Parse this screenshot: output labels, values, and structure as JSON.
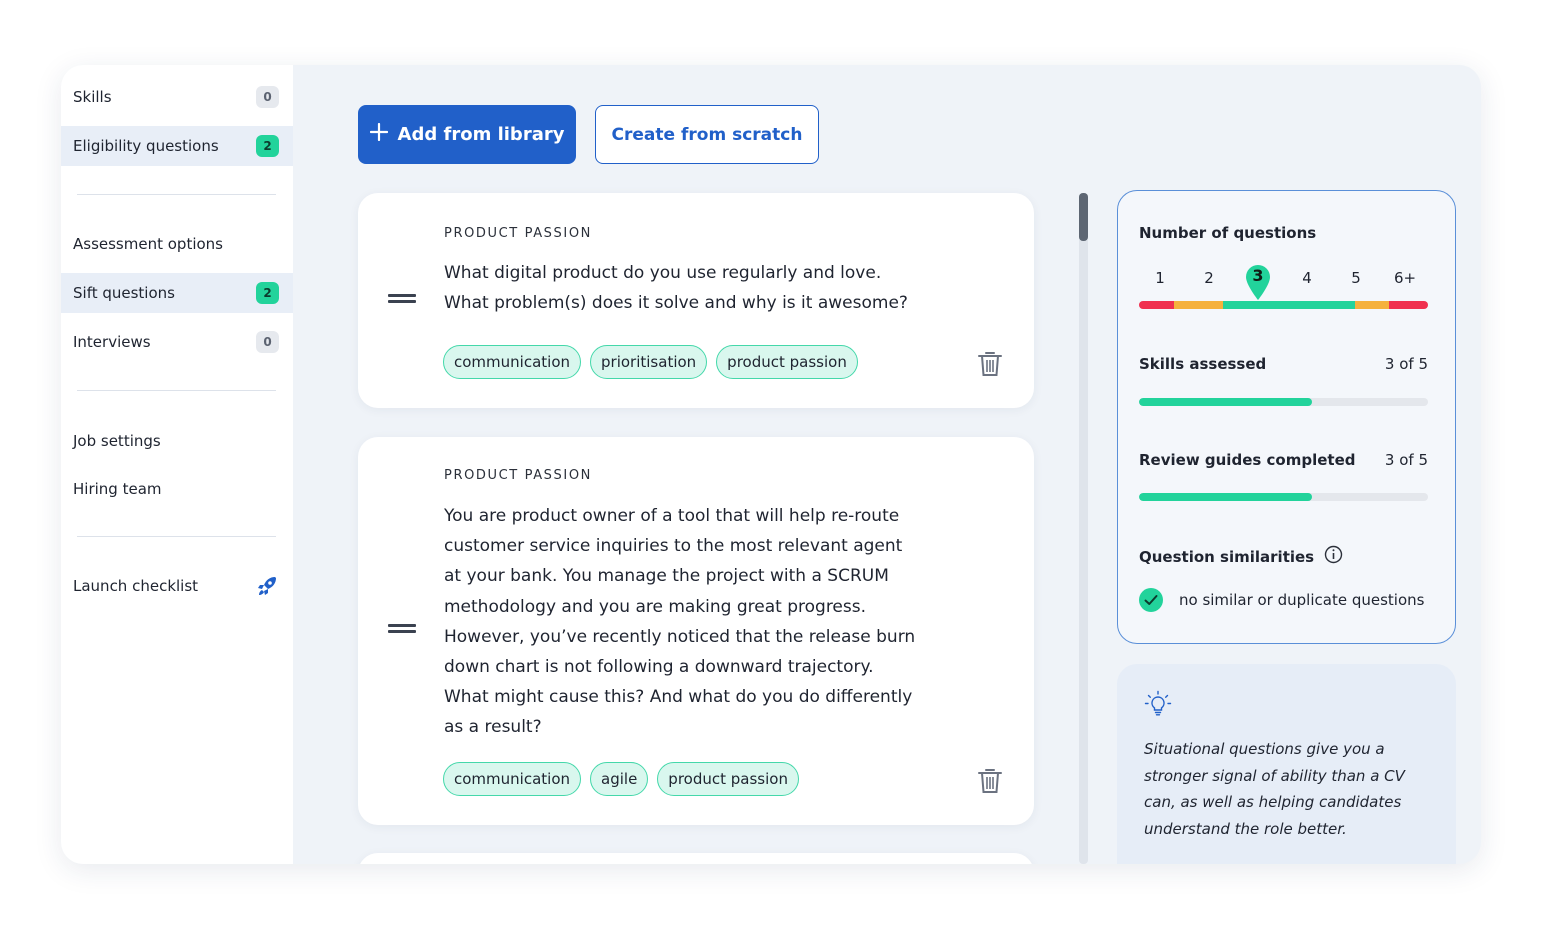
{
  "sidebar": {
    "items": [
      {
        "label": "Skills",
        "badge": "0"
      },
      {
        "label": "Eligibility questions",
        "badge": "2"
      },
      {
        "label": "Assessment options"
      },
      {
        "label": "Sift questions",
        "badge": "2"
      },
      {
        "label": "Interviews",
        "badge": "0"
      },
      {
        "label": "Job settings"
      },
      {
        "label": "Hiring team"
      },
      {
        "label": "Launch checklist",
        "icon": "rocket-icon"
      }
    ]
  },
  "toolbar": {
    "add_label": "Add from library",
    "create_label": "Create from scratch"
  },
  "questions": [
    {
      "category": "PRODUCT PASSION",
      "lines": [
        "What digital product do you use regularly and love.",
        "What problem(s) does it solve and why is it awesome?"
      ],
      "tags": [
        "communication",
        "prioritisation",
        "product passion"
      ]
    },
    {
      "category": "PRODUCT PASSION",
      "lines": [
        "You are product owner of a tool that will help re-route",
        "customer service inquiries to the most relevant agent",
        "at your bank. You manage the project with a SCRUM",
        "methodology and you are making great progress.",
        "However, you’ve recently noticed that the release burn",
        "down chart is not following a downward trajectory.",
        "What might cause this? And what do you do differently",
        "as a result?"
      ],
      "tags": [
        "communication",
        "agile",
        "product passion"
      ]
    }
  ],
  "stats": {
    "count_label": "Number of questions",
    "options": [
      "1",
      "2",
      "3",
      "4",
      "5",
      "6+"
    ],
    "selected": "3",
    "colors": {
      "red": "#f0304f",
      "orange": "#f5b13d",
      "green": "#22d39b",
      "accent": "#2160c9"
    },
    "skills_label": "Skills assessed",
    "skills_value": "3 of 5",
    "skills_fraction": 0.6,
    "guides_label": "Review guides completed",
    "guides_value": "3 of 5",
    "guides_fraction": 0.6,
    "similar_label": "Question similarities",
    "similar_status": "no similar or duplicate questions"
  },
  "tip": {
    "text": "Situational questions give you a stronger signal of ability than a CV can, as well as helping candidates understand the role better."
  }
}
